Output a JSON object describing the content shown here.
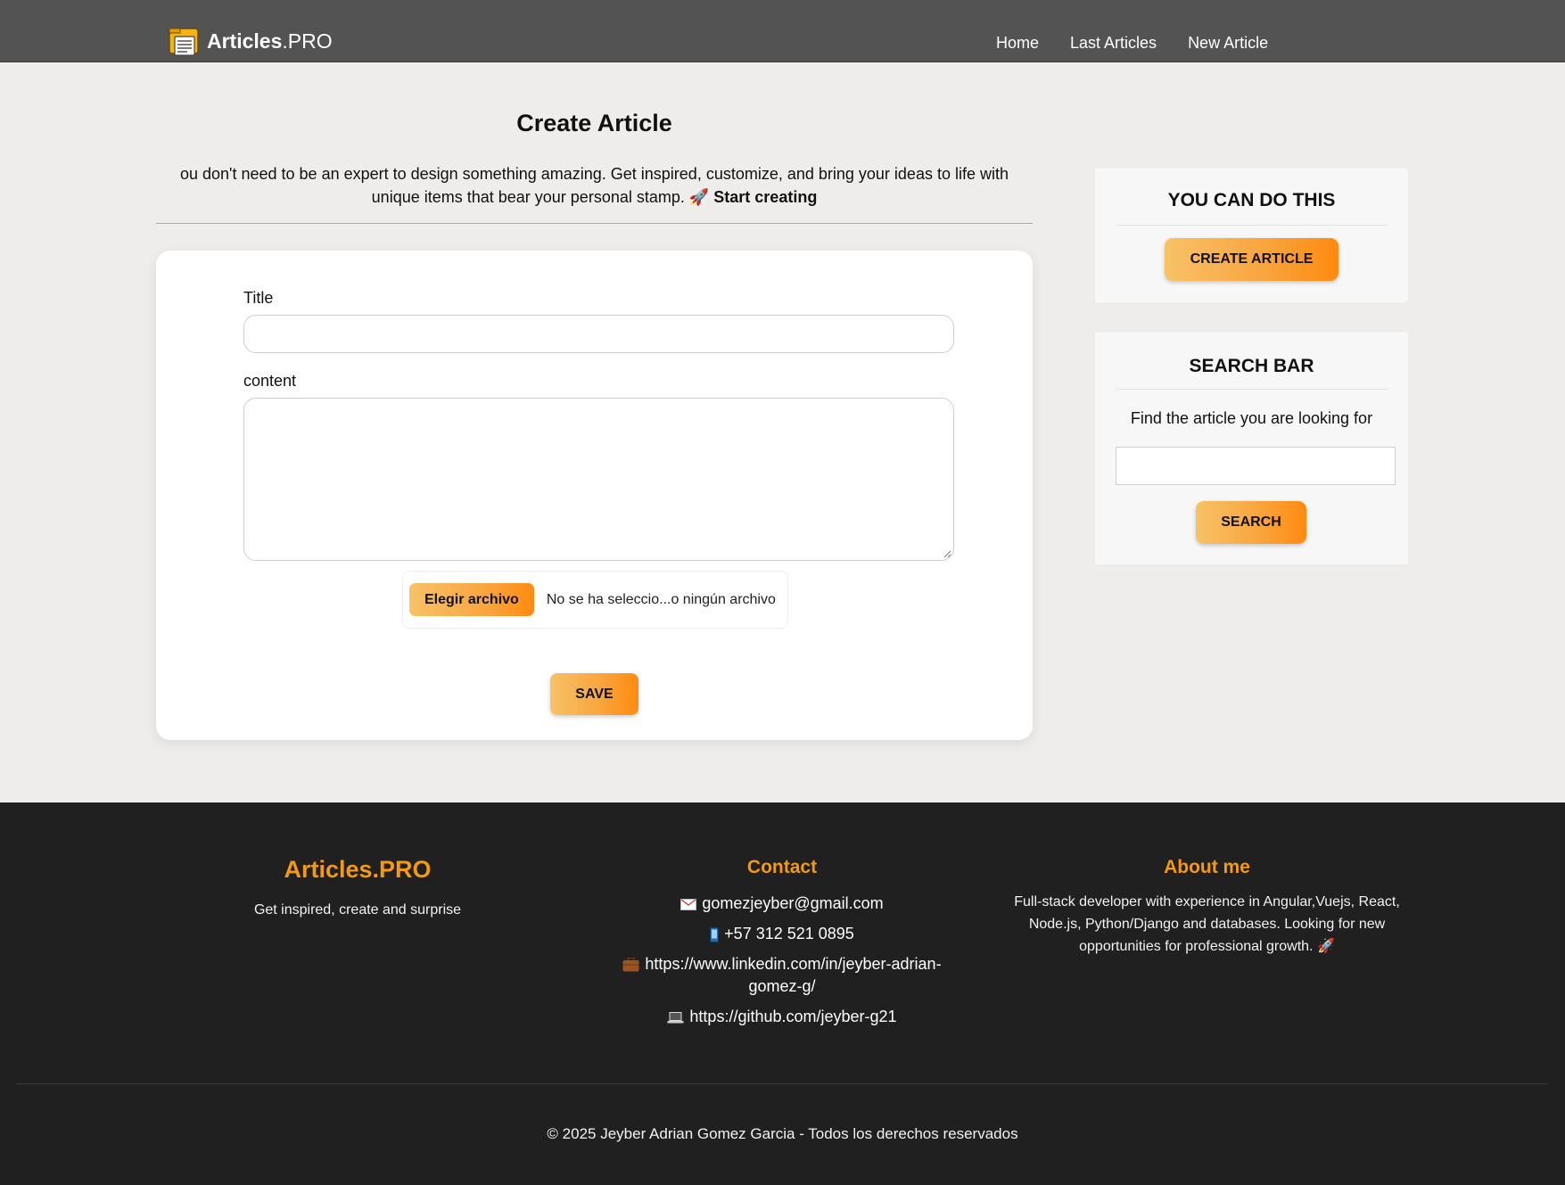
{
  "header": {
    "brand_bold": "Articles",
    "brand_light": ".PRO",
    "nav": [
      "Home",
      "Last Articles",
      "New Article"
    ]
  },
  "main": {
    "title": "Create Article",
    "intro_text": "ou don't need to be an expert to design something amazing. Get inspired, customize, and bring your ideas to life with unique items that bear your personal stamp. 🚀 ",
    "intro_cta": "Start creating",
    "form": {
      "title_label": "Title",
      "title_value": "",
      "content_label": "content",
      "content_value": "",
      "file_button": "Elegir archivo",
      "file_status": "No se ha seleccio...o ningún archivo",
      "save_button": "SAVE"
    }
  },
  "sidebar": {
    "cta_title": "YOU CAN DO THIS",
    "cta_button": "CREATE ARTICLE",
    "search_title": "SEARCH BAR",
    "search_desc": "Find the article you are looking for",
    "search_value": "",
    "search_button": "SEARCH"
  },
  "footer": {
    "brand": "Articles.PRO",
    "tagline": "Get inspired, create and surprise",
    "contact_title": "Contact",
    "email": "gomezjeyber@gmail.com",
    "phone": "+57 312 521 0895",
    "linkedin": "https://www.linkedin.com/in/jeyber-adrian-gomez-g/",
    "github": "https://github.com/jeyber-g21",
    "about_title": "About me",
    "about_text": "Full-stack developer with experience in Angular,Vuejs, React, Node.js, Python/Django and databases. Looking for new opportunities for professional growth. 🚀",
    "copyright": "© 2025 Jeyber Adrian Gomez Garcia - Todos los derechos reservados"
  },
  "colors": {
    "header_bg": "#535353",
    "page_bg": "#eeedeb",
    "accent_orange": "#f39a12",
    "footer_bg": "#202020"
  },
  "icons": {
    "logo": "folder-document-icon",
    "email": "envelope-icon",
    "phone": "mobile-phone-icon",
    "linkedin": "briefcase-icon",
    "github": "laptop-icon"
  }
}
